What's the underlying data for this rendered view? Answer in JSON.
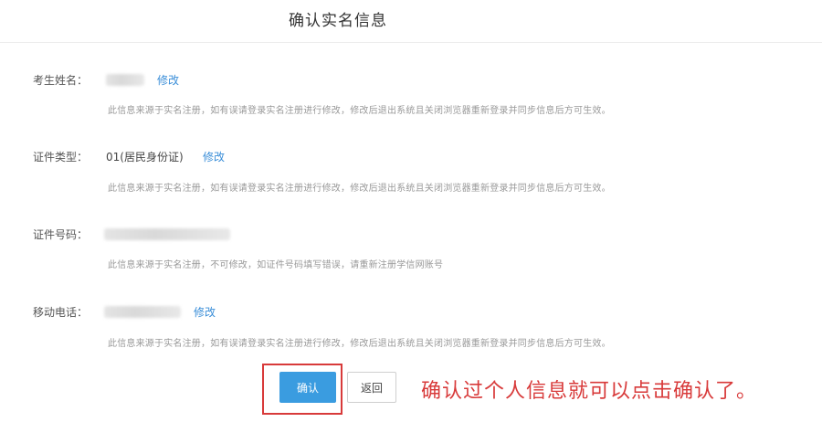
{
  "page": {
    "title": "确认实名信息"
  },
  "fields": {
    "name": {
      "label": "考生姓名：",
      "edit_label": "修改",
      "hint": "此信息来源于实名注册，如有误请登录实名注册进行修改，修改后退出系统且关闭浏览器重新登录并同步信息后方可生效。"
    },
    "id_type": {
      "label": "证件类型：",
      "value": "01(居民身份证)",
      "edit_label": "修改",
      "hint": "此信息来源于实名注册，如有误请登录实名注册进行修改，修改后退出系统且关闭浏览器重新登录并同步信息后方可生效。"
    },
    "id_number": {
      "label": "证件号码：",
      "hint": "此信息来源于实名注册，不可修改，如证件号码填写错误，请重新注册学信网账号"
    },
    "phone": {
      "label": "移动电话：",
      "edit_label": "修改",
      "hint": "此信息来源于实名注册，如有误请登录实名注册进行修改，修改后退出系统且关闭浏览器重新登录并同步信息后方可生效。"
    }
  },
  "actions": {
    "confirm_label": "确认",
    "back_label": "返回"
  },
  "annotation": {
    "text": "确认过个人信息就可以点击确认了。",
    "color": "#d83a3a"
  },
  "colors": {
    "primary": "#3a9ce0",
    "link": "#3a8ed8",
    "hint": "#999999"
  }
}
